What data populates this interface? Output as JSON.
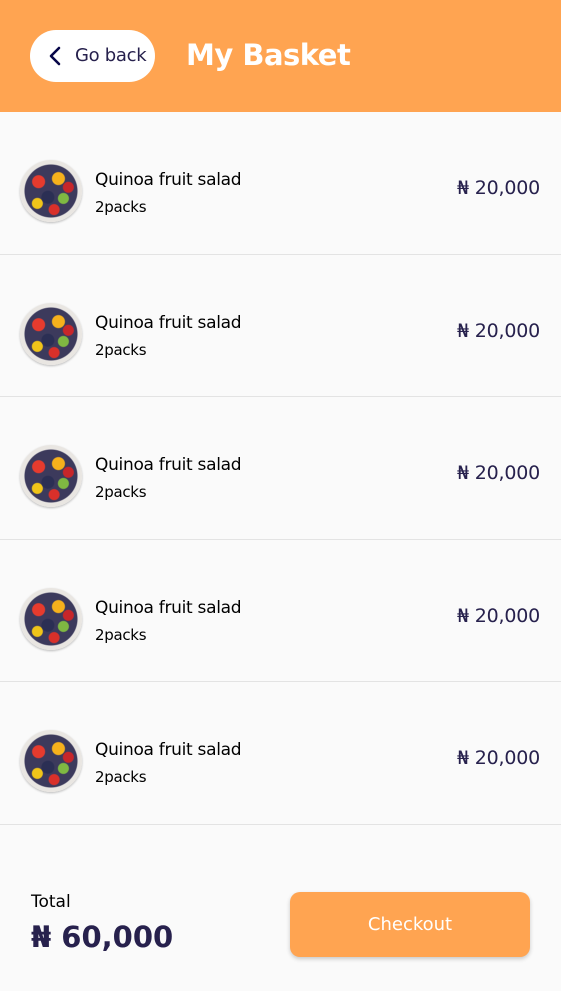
{
  "header": {
    "back_label": "Go back",
    "title": "My Basket"
  },
  "items": [
    {
      "name": "Quinoa fruit salad",
      "qty": "2packs",
      "price": "₦ 20,000"
    },
    {
      "name": "Quinoa fruit salad",
      "qty": "2packs",
      "price": "₦ 20,000"
    },
    {
      "name": "Quinoa fruit salad",
      "qty": "2packs",
      "price": "₦ 20,000"
    },
    {
      "name": "Quinoa fruit salad",
      "qty": "2packs",
      "price": "₦ 20,000"
    },
    {
      "name": "Quinoa fruit salad",
      "qty": "2packs",
      "price": "₦ 20,000"
    }
  ],
  "footer": {
    "total_label": "Total",
    "total_value": "₦ 60,000",
    "checkout_label": "Checkout"
  },
  "colors": {
    "accent": "#ffa451",
    "text_dark": "#27214d",
    "background": "#fafafa"
  },
  "icons": {
    "back": "chevron-left-icon",
    "product": "fruit-salad-image"
  }
}
